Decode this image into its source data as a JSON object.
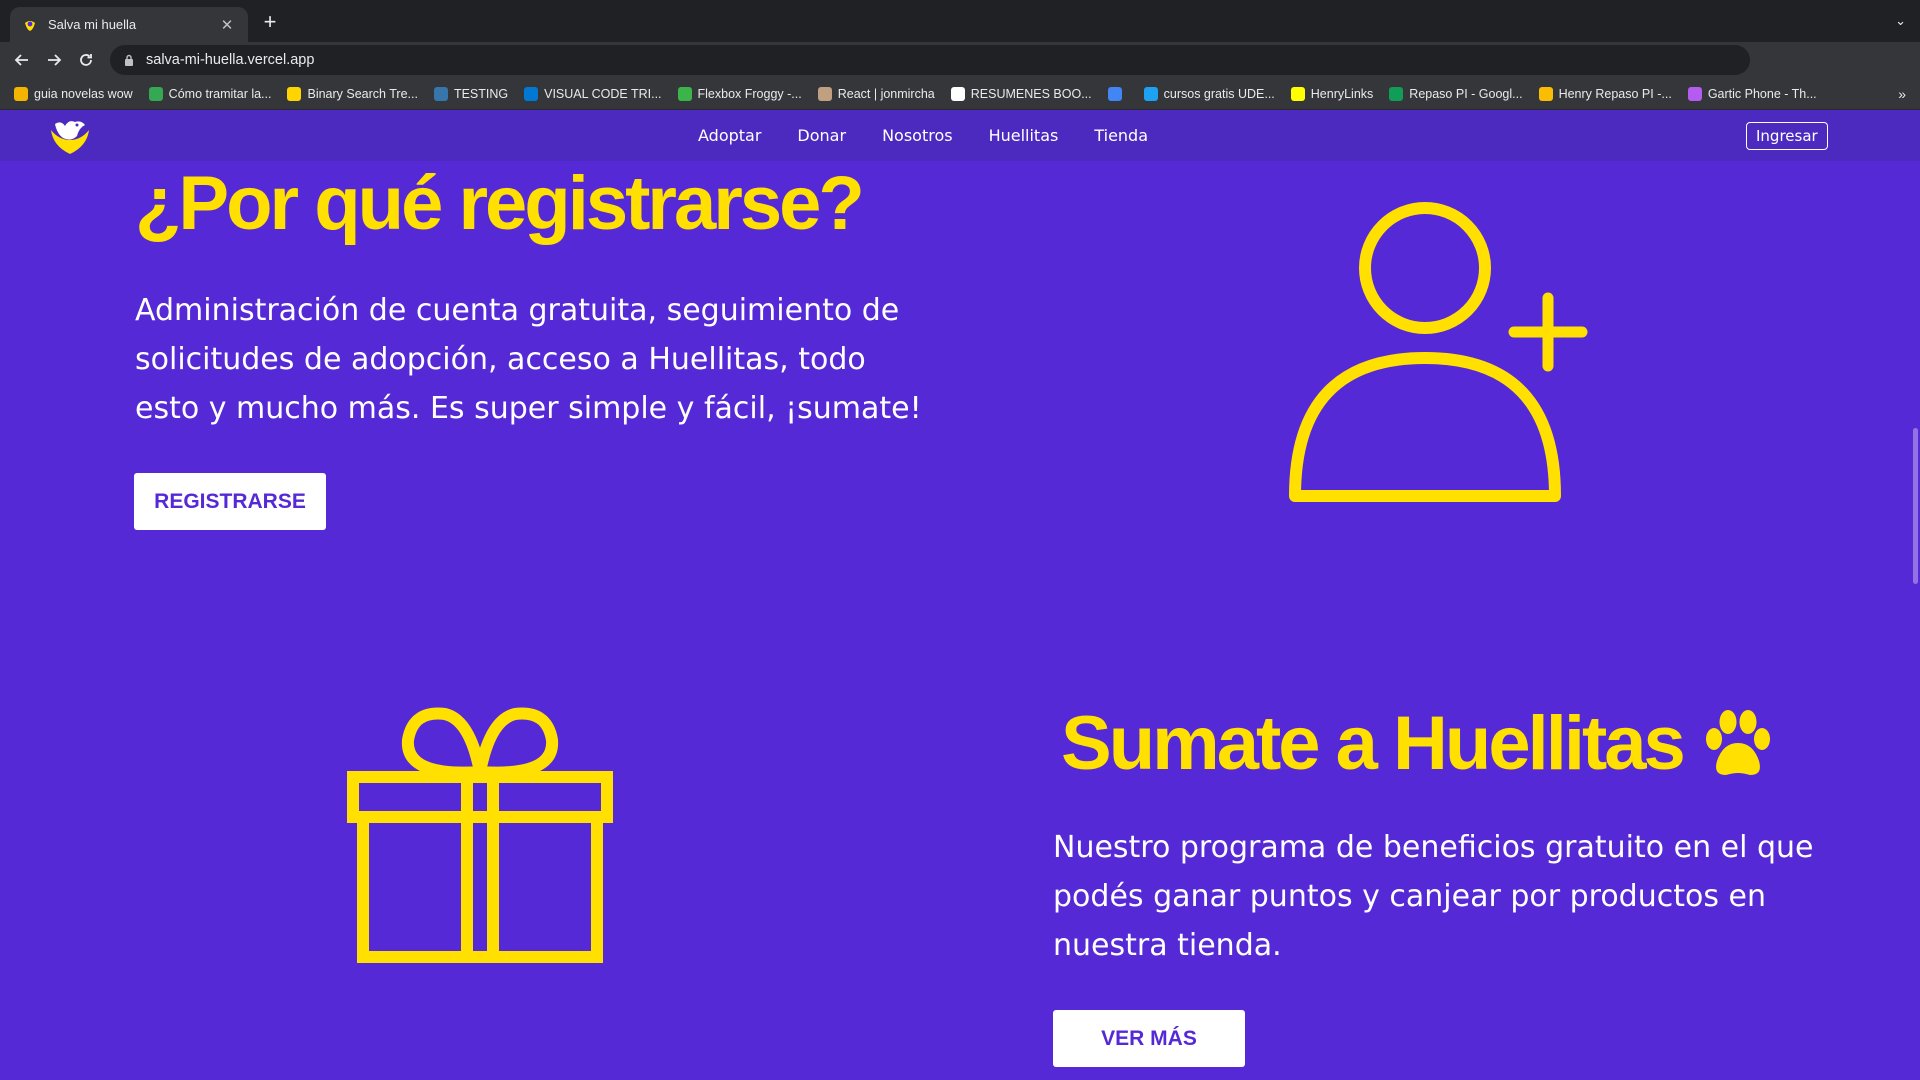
{
  "browser": {
    "tab_title": "Salva mi huella",
    "url": "salva-mi-huella.vercel.app",
    "bookmarks": [
      {
        "label": "guia novelas wow",
        "color": "#f4b400"
      },
      {
        "label": "Cómo tramitar la...",
        "color": "#34a853"
      },
      {
        "label": "Binary Search Tre...",
        "color": "#ffd400"
      },
      {
        "label": "TESTING",
        "color": "#3776ab"
      },
      {
        "label": "VISUAL CODE TRI...",
        "color": "#0078d4"
      },
      {
        "label": "Flexbox Froggy -...",
        "color": "#3bb54a"
      },
      {
        "label": "React | jonmircha",
        "color": "#c0a080"
      },
      {
        "label": "RESUMENES BOO...",
        "color": "#ffffff"
      },
      {
        "label": "",
        "color": "#4285f4"
      },
      {
        "label": "cursos gratis UDE...",
        "color": "#1da1f2"
      },
      {
        "label": "HenryLinks",
        "color": "#ffff00"
      },
      {
        "label": "Repaso PI - Googl...",
        "color": "#0f9d58"
      },
      {
        "label": "Henry Repaso PI -...",
        "color": "#fbbc04"
      },
      {
        "label": "Gartic Phone - Th...",
        "color": "#b45cf0"
      }
    ]
  },
  "site": {
    "nav": {
      "items": [
        "Adoptar",
        "Donar",
        "Nosotros",
        "Huellitas",
        "Tienda"
      ],
      "login_label": "Ingresar"
    },
    "section1": {
      "title": "¿Por qué registrarse?",
      "text": "Administración de cuenta gratuita, seguimiento de solicitudes de adopción, acceso a Huellitas, todo esto y mucho más. Es super simple y fácil, ¡sumate!",
      "cta_label": "REGISTRARSE",
      "icon": "user-plus-icon"
    },
    "section2": {
      "title": "Sumate a Huellitas",
      "text": "Nuestro programa de beneficios gratuito en el que podés ganar puntos y canjear por productos en nuestra tienda.",
      "cta_label": "VER MÁS",
      "icon": "gift-icon",
      "title_icon": "paw-icon"
    }
  },
  "colors": {
    "background": "#5629d6",
    "navbar": "#4c2ac0",
    "accent_yellow": "#ffe000",
    "text": "#ffffff"
  }
}
